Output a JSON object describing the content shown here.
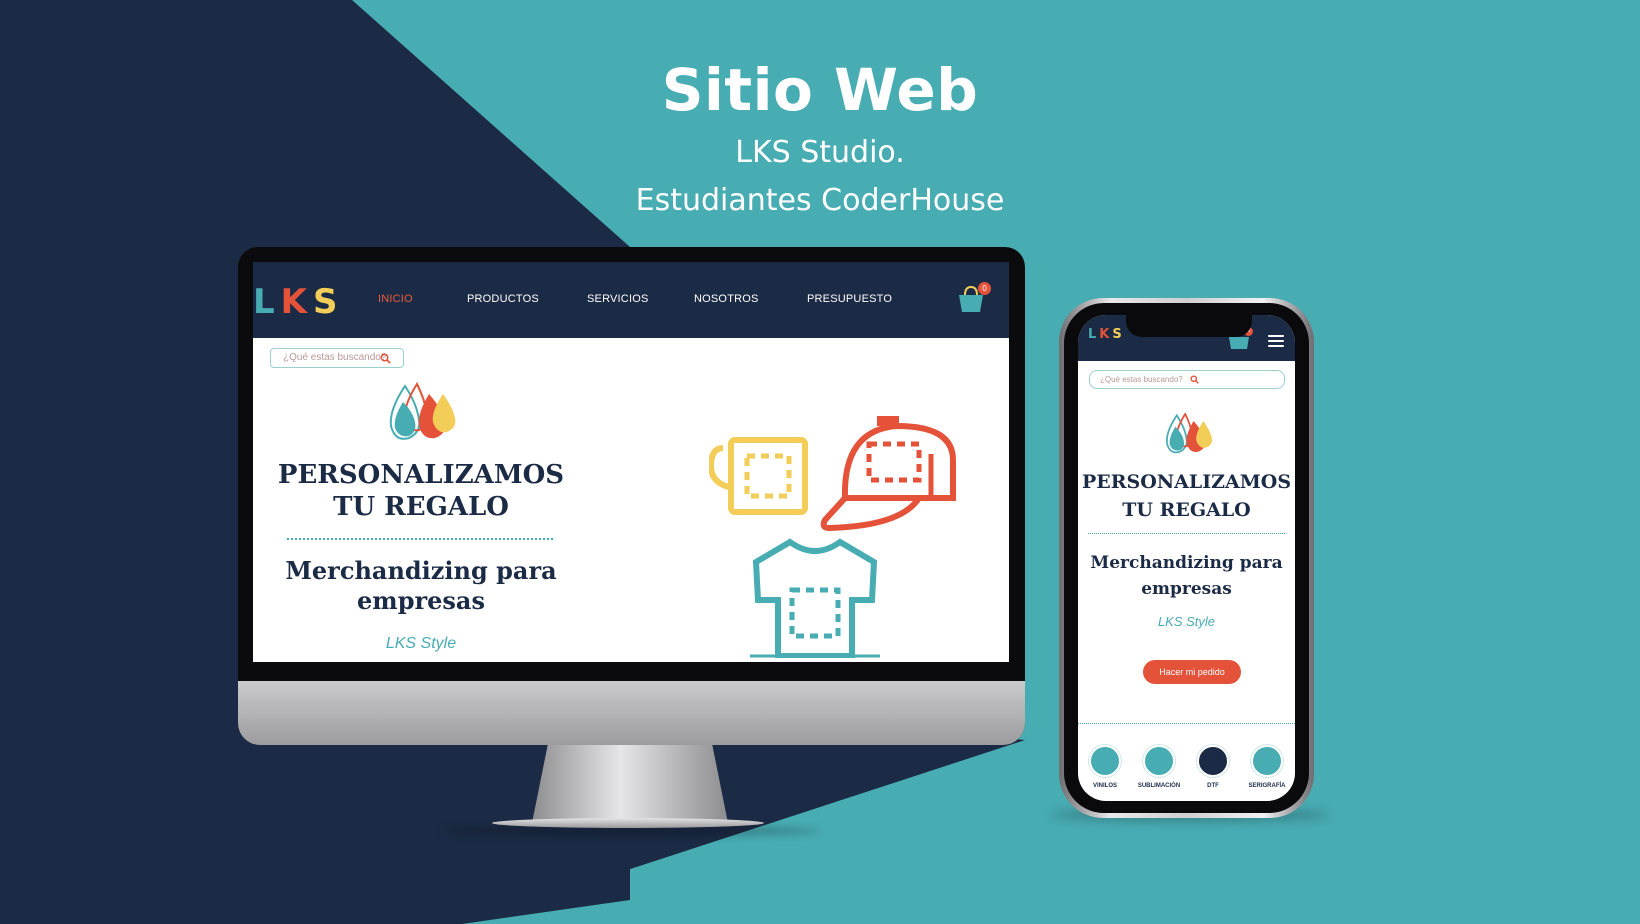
{
  "colors": {
    "background_teal": "#48acb3",
    "background_navy": "#1c2b45",
    "accent_orange": "#e4523a",
    "accent_yellow": "#f2ce59",
    "text_white": "#ffffff"
  },
  "header": {
    "title": "Sitio Web",
    "subtitle": "LKS Studio.",
    "tagline": "Estudiantes CoderHouse"
  },
  "desktop": {
    "logo_letters": [
      "L",
      "K",
      "S"
    ],
    "nav": [
      "INICIO",
      "PRODUCTOS",
      "SERVICIOS",
      "NOSOTROS",
      "PRESUPUESTO"
    ],
    "active_nav": "INICIO",
    "cart_count": "0",
    "search_placeholder": "¿Qué estas buscando?",
    "hero_title": "PERSONALIZAMOS\nTU REGALO",
    "hero_subtitle": "Merchandizing para\nempresas",
    "hero_style": "LKS Style",
    "illustrations": [
      "mug-icon",
      "cap-icon",
      "tshirt-icon"
    ]
  },
  "mobile": {
    "logo_letters": [
      "L",
      "K",
      "S"
    ],
    "cart_count": "0",
    "search_placeholder": "¿Qué estas buscando?",
    "hero_title": "PERSONALIZAMOS\nTU REGALO",
    "hero_subtitle": "Merchandizing para\nempresas",
    "hero_style": "LKS Style",
    "order_button": "Hacer mi pedido",
    "categories": [
      {
        "label": "VINILOS",
        "icon": "vinyl-icon"
      },
      {
        "label": "SUBLIMACIÓN",
        "icon": "sublimation-icon"
      },
      {
        "label": "DTF",
        "icon": "dtf-icon"
      },
      {
        "label": "SERIGRAFÍA",
        "icon": "screenprint-icon"
      }
    ]
  }
}
